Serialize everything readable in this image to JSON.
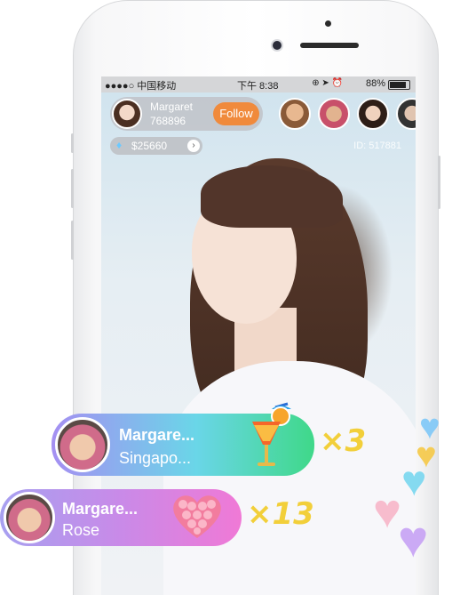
{
  "status_bar": {
    "carrier": "●●●●○ 中国移动",
    "time": "下午 8:38",
    "battery": "88%",
    "battery_level": 0.88
  },
  "host": {
    "name": "Margaret",
    "id": "768896",
    "follow_label": "Follow"
  },
  "coins": {
    "icon": "diamond-icon",
    "value": "$25660",
    "chevron": "›"
  },
  "room": {
    "id_text": "ID: 517881"
  },
  "gifts": [
    {
      "sender": "Margare...",
      "gift_text": "Singapo...",
      "multiplier": "×3",
      "gift_icon": "cocktail-icon",
      "colors": [
        "#a58ff2",
        "#6ad6e8",
        "#3fd889"
      ]
    },
    {
      "sender": "Margare...",
      "gift_text": "Rose",
      "multiplier": "×13",
      "gift_icon": "rose-heart-icon",
      "colors": [
        "#a7a0f0",
        "#c98ae8",
        "#f079d6"
      ]
    }
  ],
  "hearts": {
    "colors": [
      "#7fc8f8",
      "#f6c947",
      "#79d7f0",
      "#f8b6c9",
      "#c7a2f5"
    ]
  }
}
